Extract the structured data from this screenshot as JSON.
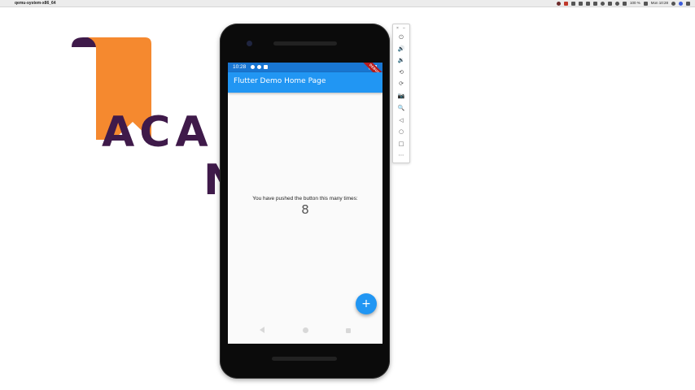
{
  "menubar": {
    "app_name": "qemu-system-x86_64",
    "battery": "100 %",
    "clock": "Mon 10:28"
  },
  "logo": {
    "line1": "ACA",
    "line2": "N"
  },
  "phone": {
    "statusbar": {
      "time": "10:28"
    },
    "debug_banner": "DEBUG",
    "appbar": {
      "title": "Flutter Demo Home Page"
    },
    "body": {
      "message": "You have pushed the button this many times:",
      "counter": "8"
    },
    "fab": {
      "label": "+",
      "icon": "add-icon"
    },
    "nav": {
      "back_icon": "back-triangle-icon",
      "home_icon": "home-circle-icon",
      "recents_icon": "recents-square-icon"
    }
  },
  "toolbar": {
    "close": "×",
    "minimize": "–",
    "buttons": [
      {
        "name": "power",
        "glyph": "⏻"
      },
      {
        "name": "volume-up",
        "glyph": "🔊"
      },
      {
        "name": "volume-down",
        "glyph": "🔉"
      },
      {
        "name": "rotate-left",
        "glyph": "⟲"
      },
      {
        "name": "rotate-right",
        "glyph": "⟳"
      },
      {
        "name": "screenshot",
        "glyph": "📷"
      },
      {
        "name": "zoom",
        "glyph": "🔍"
      },
      {
        "name": "back",
        "glyph": "◁"
      },
      {
        "name": "home",
        "glyph": "○"
      },
      {
        "name": "overview",
        "glyph": "□"
      },
      {
        "name": "more",
        "glyph": "⋯"
      }
    ]
  },
  "colors": {
    "appbar": "#2196f3",
    "statusbar": "#1976d2",
    "logo_orange": "#f5892f",
    "logo_purple": "#3f1a4a"
  }
}
